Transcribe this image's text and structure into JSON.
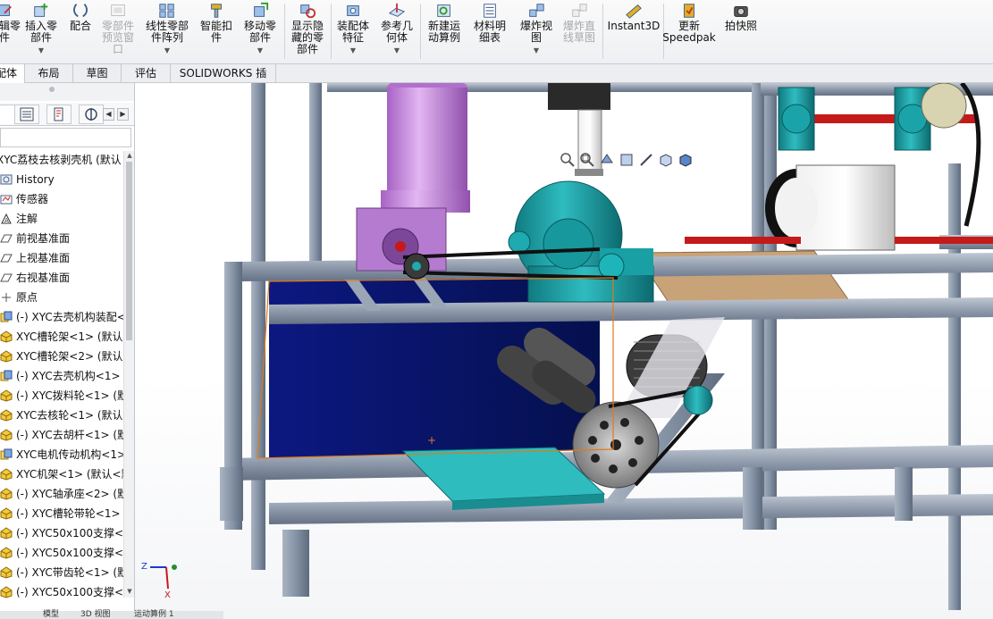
{
  "ribbon": {
    "buttons": [
      {
        "id": "edit-component",
        "label": "编辑零\n件",
        "icon": "edit-component-icon",
        "disabled": false,
        "caret": false
      },
      {
        "id": "insert-component",
        "label": "插入零\n部件",
        "icon": "insert-component-icon",
        "disabled": false,
        "caret": true
      },
      {
        "id": "mate",
        "label": "配合",
        "icon": "mate-icon",
        "disabled": false,
        "caret": false
      },
      {
        "id": "component-preview",
        "label": "零部件\n预览窗\n口",
        "icon": "component-preview-icon",
        "disabled": true,
        "caret": false
      },
      {
        "id": "linear-pattern",
        "label": "线性零部\n件阵列",
        "icon": "linear-pattern-icon",
        "disabled": false,
        "caret": true
      },
      {
        "id": "smart-fasteners",
        "label": "智能扣\n件",
        "icon": "smart-fasteners-icon",
        "disabled": false,
        "caret": false
      },
      {
        "id": "move-component",
        "label": "移动零\n部件",
        "icon": "move-component-icon",
        "disabled": false,
        "caret": true
      },
      {
        "id": "show-hidden",
        "label": "显示隐\n藏的零\n部件",
        "icon": "show-hidden-icon",
        "disabled": false,
        "caret": false
      },
      {
        "id": "assembly-features",
        "label": "装配体\n特征",
        "icon": "assembly-features-icon",
        "disabled": false,
        "caret": true
      },
      {
        "id": "reference-geometry",
        "label": "参考几\n何体",
        "icon": "reference-geometry-icon",
        "disabled": false,
        "caret": true
      },
      {
        "id": "new-motion-study",
        "label": "新建运\n动算例",
        "icon": "motion-study-icon",
        "disabled": false,
        "caret": false
      },
      {
        "id": "bill-of-materials",
        "label": "材料明\n细表",
        "icon": "bom-icon",
        "disabled": false,
        "caret": false
      },
      {
        "id": "exploded-view",
        "label": "爆炸视\n图",
        "icon": "exploded-view-icon",
        "disabled": false,
        "caret": true
      },
      {
        "id": "explode-line-sketch",
        "label": "爆炸直\n线草图",
        "icon": "explode-line-icon",
        "disabled": true,
        "caret": false
      },
      {
        "id": "instant3d",
        "label": "Instant3D",
        "icon": "instant3d-icon",
        "disabled": false,
        "caret": false
      },
      {
        "id": "update-speedpak",
        "label": "更新\nSpeedpak",
        "icon": "speedpak-icon",
        "disabled": false,
        "caret": false
      },
      {
        "id": "take-snapshot",
        "label": "拍快照",
        "icon": "camera-icon",
        "disabled": false,
        "caret": false
      }
    ]
  },
  "tabs": [
    {
      "label": "装配体",
      "active": true
    },
    {
      "label": "布局",
      "active": false
    },
    {
      "label": "草图",
      "active": false
    },
    {
      "label": "评估",
      "active": false
    },
    {
      "label": "SOLIDWORKS 插件",
      "active": false
    }
  ],
  "tree": {
    "root": "XYC荔枝去核剥壳机  (默认",
    "items": [
      {
        "label": "History",
        "icon": "history-icon"
      },
      {
        "label": "传感器",
        "icon": "sensor-icon"
      },
      {
        "label": "注解",
        "icon": "annotation-icon"
      },
      {
        "label": "前视基准面",
        "icon": "plane-icon"
      },
      {
        "label": "上视基准面",
        "icon": "plane-icon"
      },
      {
        "label": "右视基准面",
        "icon": "plane-icon"
      },
      {
        "label": "原点",
        "icon": "origin-icon"
      },
      {
        "label": "(-) XYC去壳机构装配<",
        "icon": "subassembly-icon"
      },
      {
        "label": "XYC槽轮架<1> (默认",
        "icon": "part-icon"
      },
      {
        "label": "XYC槽轮架<2> (默认",
        "icon": "part-icon"
      },
      {
        "label": "(-) XYC去壳机构<1>",
        "icon": "subassembly-icon"
      },
      {
        "label": "(-) XYC拨料轮<1> (默",
        "icon": "part-icon"
      },
      {
        "label": "XYC去核轮<1> (默认",
        "icon": "part-icon"
      },
      {
        "label": "(-) XYC去胡杆<1> (默",
        "icon": "part-icon"
      },
      {
        "label": "XYC电机传动机构<1>",
        "icon": "subassembly-icon"
      },
      {
        "label": "XYC机架<1> (默认<默",
        "icon": "part-icon"
      },
      {
        "label": "(-) XYC轴承座<2> (默",
        "icon": "part-icon"
      },
      {
        "label": "(-) XYC槽轮带轮<1>",
        "icon": "part-icon"
      },
      {
        "label": "(-) XYC50x100支撑<4",
        "icon": "part-icon"
      },
      {
        "label": "(-) XYC50x100支撑<5",
        "icon": "part-icon"
      },
      {
        "label": "(-) XYC带齿轮<1> (默",
        "icon": "part-icon"
      },
      {
        "label": "(-) XYC50x100支撑<6",
        "icon": "part-icon"
      }
    ]
  },
  "bottom_tabs": [
    "模型",
    "3D 视图",
    "运动算例 1"
  ],
  "triad": {
    "z": "Z",
    "x": "X"
  },
  "colors": {
    "frame": "#8a97a9",
    "teal": "#1fa3a8",
    "motor_purple": "#c78be0",
    "navy_panel": "#0a1470",
    "wood": "#c9a378",
    "red_shaft": "#c41a1a",
    "selection_orange": "#e07a1a"
  }
}
